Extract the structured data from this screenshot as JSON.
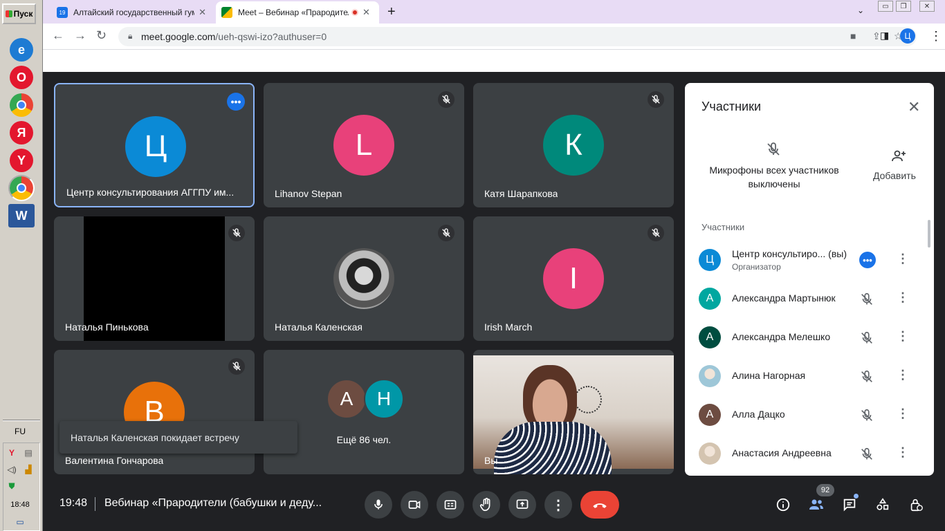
{
  "taskbar": {
    "start_label": "Пуск",
    "apps": [
      {
        "name": "internet-explorer",
        "glyph": "e",
        "color": "#1e7bd3"
      },
      {
        "name": "opera",
        "glyph": "O",
        "color": "#e3172e"
      },
      {
        "name": "chrome",
        "glyph": "",
        "color": "#4285f4"
      },
      {
        "name": "yandex",
        "glyph": "Я",
        "color": "#e3172e"
      },
      {
        "name": "yandex-browser",
        "glyph": "Y",
        "color": "#e3172e"
      },
      {
        "name": "chrome-profile",
        "glyph": "",
        "color": "#4285f4"
      },
      {
        "name": "word",
        "glyph": "W",
        "color": "#2b579a"
      }
    ],
    "language": "FU",
    "clock": "18:48"
  },
  "browser": {
    "tabs": [
      {
        "favicon_text": "19",
        "favicon_color": "#1a73e8",
        "title": "Алтайский государственный гума",
        "active": false
      },
      {
        "favicon_text": "",
        "favicon_color": "#00897b",
        "title": "Meet – Вебинар «Прародители",
        "active": true
      }
    ],
    "url_host": "meet.google.com",
    "url_path": "/ueh-qswi-izo?authuser=0",
    "profile_initial": "Ц"
  },
  "tiles": [
    {
      "name": "Центр консультирования АГГПУ им...",
      "initial": "Ц",
      "color": "#0b8ad6",
      "muted": false,
      "active": true,
      "kind": "avatar"
    },
    {
      "name": "Lihanov Stepan",
      "initial": "L",
      "color": "#e8417a",
      "muted": true,
      "active": false,
      "kind": "avatar"
    },
    {
      "name": "Катя Шарапкова",
      "initial": "К",
      "color": "#00897b",
      "muted": true,
      "active": false,
      "kind": "avatar"
    },
    {
      "name": "Наталья Пинькова",
      "initial": "",
      "color": "#000000",
      "muted": true,
      "active": false,
      "kind": "video-black"
    },
    {
      "name": "Наталья Каленская",
      "initial": "",
      "color": "#9e9e9e",
      "muted": true,
      "active": false,
      "kind": "photo"
    },
    {
      "name": "Irish March",
      "initial": "I",
      "color": "#e8417a",
      "muted": true,
      "active": false,
      "kind": "avatar"
    },
    {
      "name": "Валентина Гончарова",
      "initial": "В",
      "color": "#e8710a",
      "muted": true,
      "active": false,
      "kind": "avatar"
    },
    {
      "name": "Ещё 86 чел.",
      "initial": "",
      "color": "",
      "muted": false,
      "active": false,
      "kind": "more",
      "extra": [
        {
          "initial": "А",
          "color": "#6d4c41"
        },
        {
          "initial": "Н",
          "color": "#0097a7"
        }
      ]
    },
    {
      "name": "Вы",
      "initial": "",
      "color": "#cfc6bd",
      "muted": false,
      "active": false,
      "kind": "self-video"
    }
  ],
  "toast": "Наталья Каленская покидает встречу",
  "panel": {
    "title": "Участники",
    "mute_all_text": "Микрофоны всех участников выключены",
    "add_label": "Добавить",
    "section_label": "Участники",
    "participants": [
      {
        "name": "Центр консультиро...  (вы)",
        "role": "Организатор",
        "initial": "Ц",
        "color": "#0b8ad6",
        "status": "host"
      },
      {
        "name": "Александра Мартынюк",
        "role": "",
        "initial": "А",
        "color": "#00a7a0",
        "status": "muted"
      },
      {
        "name": "Александра Мелешко",
        "role": "",
        "initial": "А",
        "color": "#004d40",
        "status": "muted"
      },
      {
        "name": "Алина Нагорная",
        "role": "",
        "initial": "",
        "color": "#9ec7d8",
        "status": "muted"
      },
      {
        "name": "Алла Дацко",
        "role": "",
        "initial": "А",
        "color": "#6d4c41",
        "status": "muted"
      },
      {
        "name": "Анастасия Андреевна",
        "role": "",
        "initial": "",
        "color": "#d4c4b0",
        "status": "muted"
      }
    ]
  },
  "bottom": {
    "time": "19:48",
    "meeting_title": "Вебинар «Прародители (бабушки и деду...",
    "participant_count": "92"
  },
  "colors": {
    "meet_bg": "#202124",
    "tile_bg": "#3c4043",
    "accent_blue": "#1a73e8",
    "end_call_red": "#ea4335"
  }
}
